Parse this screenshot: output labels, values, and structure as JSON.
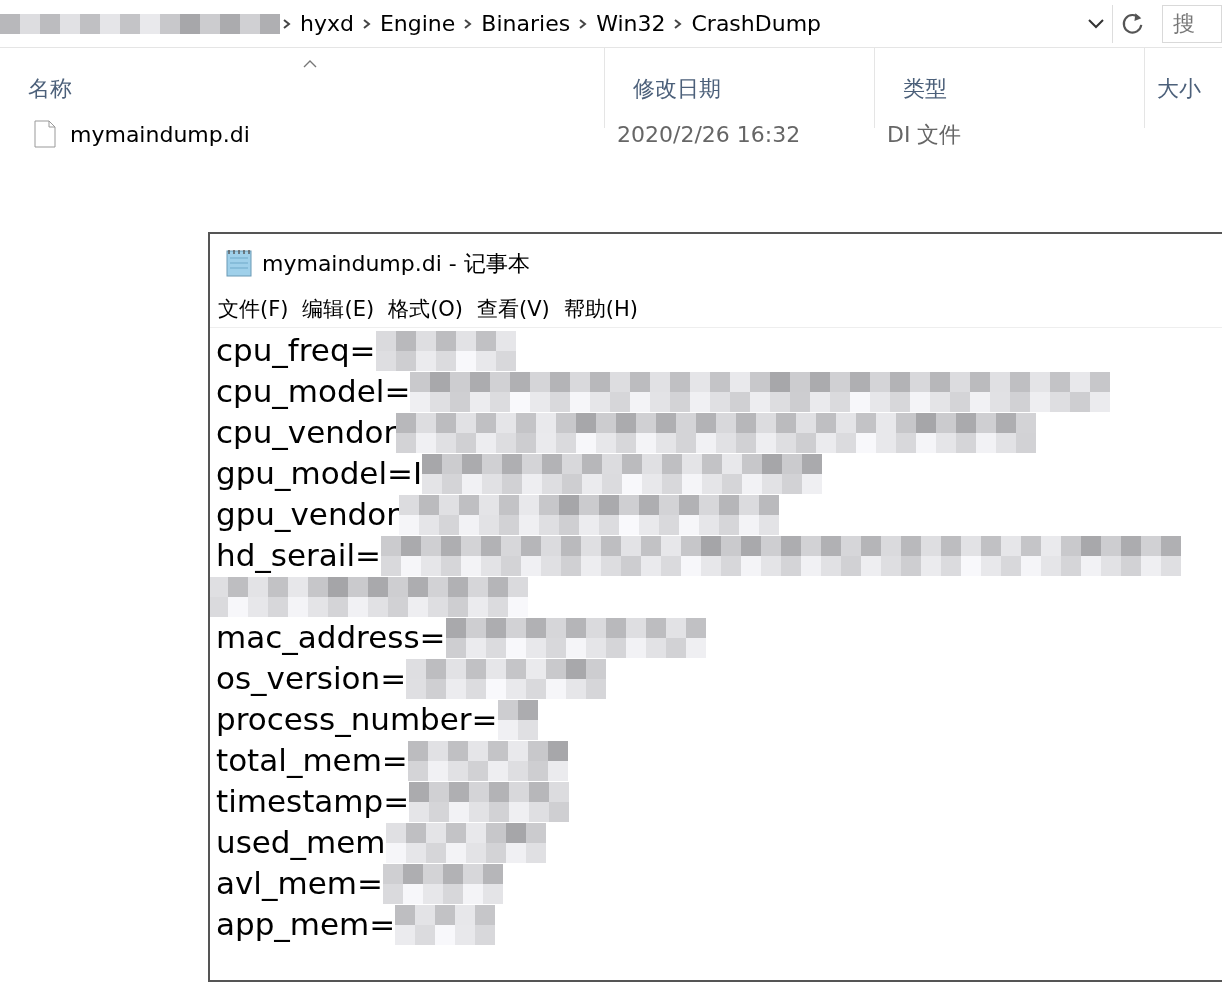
{
  "address_bar": {
    "redacted_prefix": true,
    "crumbs": [
      "hyxd",
      "Engine",
      "Binaries",
      "Win32",
      "CrashDump"
    ],
    "search": {
      "placeholder": "搜"
    }
  },
  "columns": [
    {
      "label": "名称",
      "sorted": true
    },
    {
      "label": "修改日期",
      "sorted": false
    },
    {
      "label": "类型",
      "sorted": false
    },
    {
      "label": "大小",
      "sorted": false
    }
  ],
  "files": [
    {
      "name": "mymaindump.di",
      "modified": "2020/2/26 16:32",
      "type": "DI 文件"
    }
  ],
  "notepad": {
    "title": "mymaindump.di - 记事本",
    "menu": [
      "文件(F)",
      "编辑(E)",
      "格式(O)",
      "查看(V)",
      "帮助(H)"
    ],
    "lines": [
      {
        "text": "cpu_freq=",
        "redacted": true
      },
      {
        "text": "cpu_model=",
        "redacted": true
      },
      {
        "text": "cpu_vendor",
        "redacted": true
      },
      {
        "text": "gpu_model=I",
        "redacted": true
      },
      {
        "text": "gpu_vendor",
        "redacted": true
      },
      {
        "text": "hd_serail=",
        "redacted": true
      },
      {
        "redacted": true
      },
      {
        "text": "mac_address=",
        "redacted": true
      },
      {
        "text": "os_version=",
        "redacted": true
      },
      {
        "text": "process_number=",
        "redacted": true
      },
      {
        "text": "total_mem=",
        "redacted": true
      },
      {
        "text": "timestamp=",
        "redacted": true
      },
      {
        "text": "used_mem",
        "redacted": true
      },
      {
        "text": "avl_mem=",
        "redacted": true
      },
      {
        "text": "app_mem=",
        "redacted": true
      }
    ]
  }
}
